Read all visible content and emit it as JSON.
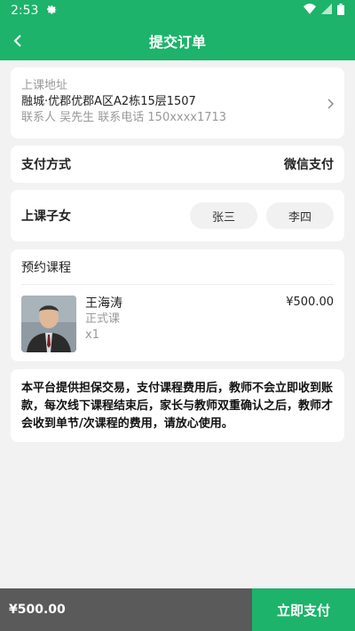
{
  "status_bar": {
    "time": "2:53"
  },
  "header": {
    "title": "提交订单"
  },
  "address": {
    "label": "上课地址",
    "detail": "融城·优郡优郡A区A2栋15层1507",
    "contact": "联系人 吴先生  联系电话  150xxxx1713"
  },
  "payment": {
    "label": "支付方式",
    "value": "微信支付"
  },
  "child": {
    "label": "上课子女",
    "options": [
      "张三",
      "李四"
    ]
  },
  "course": {
    "header": "预约课程",
    "teacher": "王海涛",
    "type": "正式课",
    "qty": "x1",
    "price": "¥500.00"
  },
  "notice": "本平台提供担保交易，支付课程费用后，教师不会立即收到账款，每次线下课程结束后，家长与教师双重确认之后，教师才会收到单节/次课程的费用，请放心使用。",
  "footer": {
    "total": "¥500.00",
    "pay_button": "立即支付"
  },
  "colors": {
    "brand": "#1db36a",
    "footer_dark": "#5a5a5a"
  }
}
